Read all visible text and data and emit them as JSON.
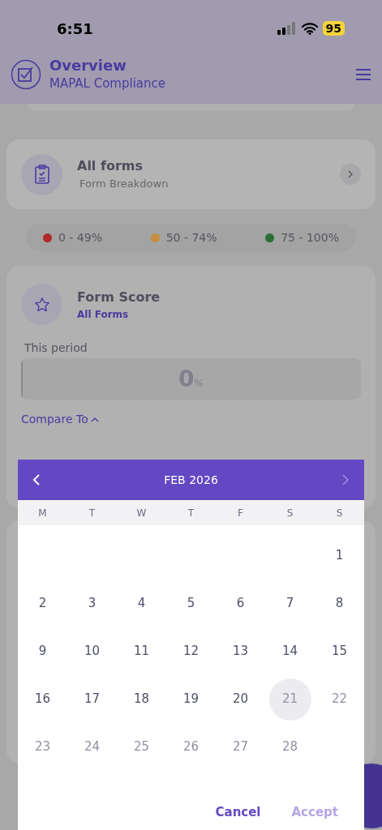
{
  "status_bar": {
    "time": "6:51",
    "battery": "95"
  },
  "header": {
    "title": "Overview",
    "subtitle": "MAPAL Compliance"
  },
  "forms_card": {
    "title": "All forms",
    "subtitle": "Form Breakdown"
  },
  "legend": [
    {
      "label": "0 - 49%",
      "color": "#b02a2a"
    },
    {
      "label": "50 - 74%",
      "color": "#c98f3d"
    },
    {
      "label": "75 - 100%",
      "color": "#2a6e34"
    }
  ],
  "score_card": {
    "title": "Form Score",
    "subtitle": "All Forms",
    "period_label": "This period",
    "score": "0",
    "unit": "%",
    "level": 0,
    "compare_label": "Compare To"
  },
  "calendar": {
    "month": "FEB 2026",
    "weekdays": [
      "M",
      "T",
      "W",
      "T",
      "F",
      "S",
      "S"
    ],
    "weeks": [
      [
        {
          "label": "1",
          "disabled": false,
          "highlighted": false
        }
      ],
      [
        {
          "label": "2",
          "disabled": false,
          "highlighted": false
        },
        {
          "label": "3",
          "disabled": false,
          "highlighted": false
        },
        {
          "label": "4",
          "disabled": false,
          "highlighted": false
        },
        {
          "label": "5",
          "disabled": false,
          "highlighted": false
        },
        {
          "label": "6",
          "disabled": false,
          "highlighted": false
        },
        {
          "label": "7",
          "disabled": false,
          "highlighted": false
        },
        {
          "label": "8",
          "disabled": false,
          "highlighted": false
        }
      ],
      [
        {
          "label": "9",
          "disabled": false,
          "highlighted": false
        },
        {
          "label": "10",
          "disabled": false,
          "highlighted": false
        },
        {
          "label": "11",
          "disabled": false,
          "highlighted": false
        },
        {
          "label": "12",
          "disabled": false,
          "highlighted": false
        },
        {
          "label": "13",
          "disabled": false,
          "highlighted": false
        },
        {
          "label": "14",
          "disabled": false,
          "highlighted": false
        },
        {
          "label": "15",
          "disabled": false,
          "highlighted": false
        }
      ],
      [
        {
          "label": "16",
          "disabled": false,
          "highlighted": false
        },
        {
          "label": "17",
          "disabled": false,
          "highlighted": false
        },
        {
          "label": "18",
          "disabled": false,
          "highlighted": false
        },
        {
          "label": "19",
          "disabled": false,
          "highlighted": false
        },
        {
          "label": "20",
          "disabled": false,
          "highlighted": false
        },
        {
          "label": "21",
          "disabled": true,
          "highlighted": true
        },
        {
          "label": "22",
          "disabled": true,
          "highlighted": false
        }
      ],
      [
        {
          "label": "23",
          "disabled": true,
          "highlighted": false
        },
        {
          "label": "24",
          "disabled": true,
          "highlighted": false
        },
        {
          "label": "25",
          "disabled": true,
          "highlighted": false
        },
        {
          "label": "26",
          "disabled": true,
          "highlighted": false
        },
        {
          "label": "27",
          "disabled": true,
          "highlighted": false
        },
        {
          "label": "28",
          "disabled": true,
          "highlighted": false
        }
      ]
    ],
    "buttons": [
      {
        "label": "Cancel",
        "disabled": false
      },
      {
        "label": "Accept",
        "disabled": true
      }
    ]
  }
}
